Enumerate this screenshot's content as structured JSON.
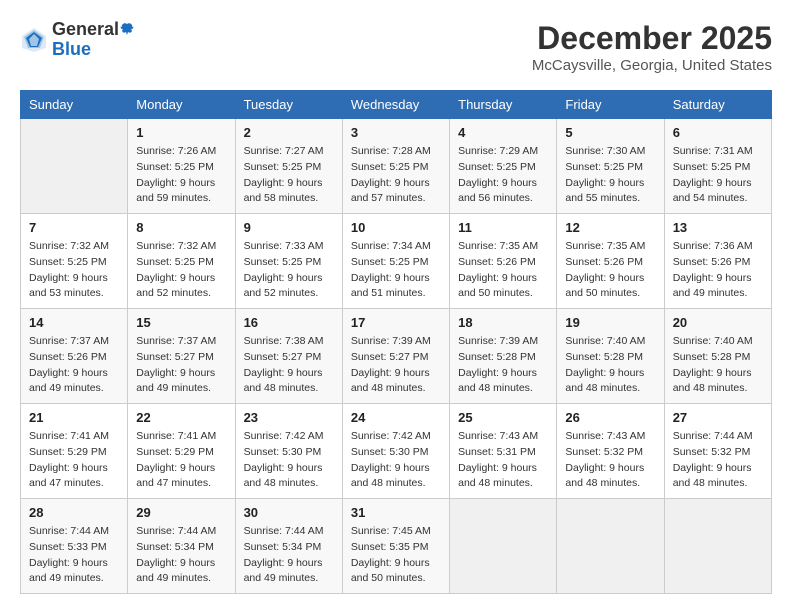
{
  "header": {
    "logo_general": "General",
    "logo_blue": "Blue",
    "month": "December 2025",
    "location": "McCaysville, Georgia, United States"
  },
  "days_of_week": [
    "Sunday",
    "Monday",
    "Tuesday",
    "Wednesday",
    "Thursday",
    "Friday",
    "Saturday"
  ],
  "weeks": [
    [
      {
        "day": "",
        "sunrise": "",
        "sunset": "",
        "daylight": ""
      },
      {
        "day": "1",
        "sunrise": "Sunrise: 7:26 AM",
        "sunset": "Sunset: 5:25 PM",
        "daylight": "Daylight: 9 hours and 59 minutes."
      },
      {
        "day": "2",
        "sunrise": "Sunrise: 7:27 AM",
        "sunset": "Sunset: 5:25 PM",
        "daylight": "Daylight: 9 hours and 58 minutes."
      },
      {
        "day": "3",
        "sunrise": "Sunrise: 7:28 AM",
        "sunset": "Sunset: 5:25 PM",
        "daylight": "Daylight: 9 hours and 57 minutes."
      },
      {
        "day": "4",
        "sunrise": "Sunrise: 7:29 AM",
        "sunset": "Sunset: 5:25 PM",
        "daylight": "Daylight: 9 hours and 56 minutes."
      },
      {
        "day": "5",
        "sunrise": "Sunrise: 7:30 AM",
        "sunset": "Sunset: 5:25 PM",
        "daylight": "Daylight: 9 hours and 55 minutes."
      },
      {
        "day": "6",
        "sunrise": "Sunrise: 7:31 AM",
        "sunset": "Sunset: 5:25 PM",
        "daylight": "Daylight: 9 hours and 54 minutes."
      }
    ],
    [
      {
        "day": "7",
        "sunrise": "Sunrise: 7:32 AM",
        "sunset": "Sunset: 5:25 PM",
        "daylight": "Daylight: 9 hours and 53 minutes."
      },
      {
        "day": "8",
        "sunrise": "Sunrise: 7:32 AM",
        "sunset": "Sunset: 5:25 PM",
        "daylight": "Daylight: 9 hours and 52 minutes."
      },
      {
        "day": "9",
        "sunrise": "Sunrise: 7:33 AM",
        "sunset": "Sunset: 5:25 PM",
        "daylight": "Daylight: 9 hours and 52 minutes."
      },
      {
        "day": "10",
        "sunrise": "Sunrise: 7:34 AM",
        "sunset": "Sunset: 5:25 PM",
        "daylight": "Daylight: 9 hours and 51 minutes."
      },
      {
        "day": "11",
        "sunrise": "Sunrise: 7:35 AM",
        "sunset": "Sunset: 5:26 PM",
        "daylight": "Daylight: 9 hours and 50 minutes."
      },
      {
        "day": "12",
        "sunrise": "Sunrise: 7:35 AM",
        "sunset": "Sunset: 5:26 PM",
        "daylight": "Daylight: 9 hours and 50 minutes."
      },
      {
        "day": "13",
        "sunrise": "Sunrise: 7:36 AM",
        "sunset": "Sunset: 5:26 PM",
        "daylight": "Daylight: 9 hours and 49 minutes."
      }
    ],
    [
      {
        "day": "14",
        "sunrise": "Sunrise: 7:37 AM",
        "sunset": "Sunset: 5:26 PM",
        "daylight": "Daylight: 9 hours and 49 minutes."
      },
      {
        "day": "15",
        "sunrise": "Sunrise: 7:37 AM",
        "sunset": "Sunset: 5:27 PM",
        "daylight": "Daylight: 9 hours and 49 minutes."
      },
      {
        "day": "16",
        "sunrise": "Sunrise: 7:38 AM",
        "sunset": "Sunset: 5:27 PM",
        "daylight": "Daylight: 9 hours and 48 minutes."
      },
      {
        "day": "17",
        "sunrise": "Sunrise: 7:39 AM",
        "sunset": "Sunset: 5:27 PM",
        "daylight": "Daylight: 9 hours and 48 minutes."
      },
      {
        "day": "18",
        "sunrise": "Sunrise: 7:39 AM",
        "sunset": "Sunset: 5:28 PM",
        "daylight": "Daylight: 9 hours and 48 minutes."
      },
      {
        "day": "19",
        "sunrise": "Sunrise: 7:40 AM",
        "sunset": "Sunset: 5:28 PM",
        "daylight": "Daylight: 9 hours and 48 minutes."
      },
      {
        "day": "20",
        "sunrise": "Sunrise: 7:40 AM",
        "sunset": "Sunset: 5:28 PM",
        "daylight": "Daylight: 9 hours and 48 minutes."
      }
    ],
    [
      {
        "day": "21",
        "sunrise": "Sunrise: 7:41 AM",
        "sunset": "Sunset: 5:29 PM",
        "daylight": "Daylight: 9 hours and 47 minutes."
      },
      {
        "day": "22",
        "sunrise": "Sunrise: 7:41 AM",
        "sunset": "Sunset: 5:29 PM",
        "daylight": "Daylight: 9 hours and 47 minutes."
      },
      {
        "day": "23",
        "sunrise": "Sunrise: 7:42 AM",
        "sunset": "Sunset: 5:30 PM",
        "daylight": "Daylight: 9 hours and 48 minutes."
      },
      {
        "day": "24",
        "sunrise": "Sunrise: 7:42 AM",
        "sunset": "Sunset: 5:30 PM",
        "daylight": "Daylight: 9 hours and 48 minutes."
      },
      {
        "day": "25",
        "sunrise": "Sunrise: 7:43 AM",
        "sunset": "Sunset: 5:31 PM",
        "daylight": "Daylight: 9 hours and 48 minutes."
      },
      {
        "day": "26",
        "sunrise": "Sunrise: 7:43 AM",
        "sunset": "Sunset: 5:32 PM",
        "daylight": "Daylight: 9 hours and 48 minutes."
      },
      {
        "day": "27",
        "sunrise": "Sunrise: 7:44 AM",
        "sunset": "Sunset: 5:32 PM",
        "daylight": "Daylight: 9 hours and 48 minutes."
      }
    ],
    [
      {
        "day": "28",
        "sunrise": "Sunrise: 7:44 AM",
        "sunset": "Sunset: 5:33 PM",
        "daylight": "Daylight: 9 hours and 49 minutes."
      },
      {
        "day": "29",
        "sunrise": "Sunrise: 7:44 AM",
        "sunset": "Sunset: 5:34 PM",
        "daylight": "Daylight: 9 hours and 49 minutes."
      },
      {
        "day": "30",
        "sunrise": "Sunrise: 7:44 AM",
        "sunset": "Sunset: 5:34 PM",
        "daylight": "Daylight: 9 hours and 49 minutes."
      },
      {
        "day": "31",
        "sunrise": "Sunrise: 7:45 AM",
        "sunset": "Sunset: 5:35 PM",
        "daylight": "Daylight: 9 hours and 50 minutes."
      },
      {
        "day": "",
        "sunrise": "",
        "sunset": "",
        "daylight": ""
      },
      {
        "day": "",
        "sunrise": "",
        "sunset": "",
        "daylight": ""
      },
      {
        "day": "",
        "sunrise": "",
        "sunset": "",
        "daylight": ""
      }
    ]
  ]
}
